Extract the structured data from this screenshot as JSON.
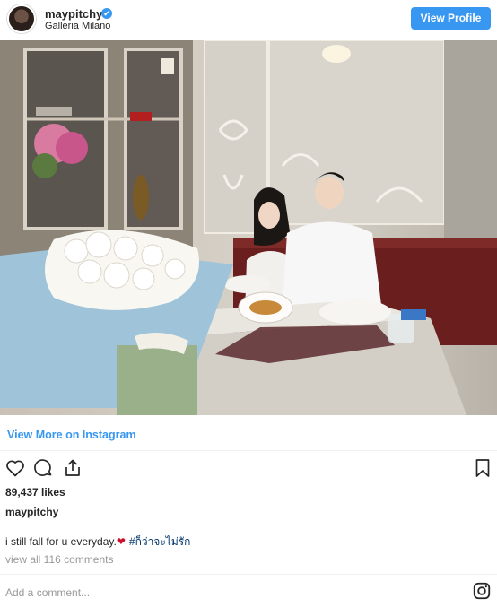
{
  "header": {
    "username": "maypitchy",
    "verified_mark": "✔",
    "location": "Galleria Milano",
    "view_profile_label": "View Profile"
  },
  "post": {
    "view_more_label": "View More on Instagram",
    "likes": "89,437 likes",
    "caption_username": "maypitchy",
    "caption_text": "i still fall for u everyday.",
    "caption_emoji": "❤",
    "caption_hashtag": "#ก็ว่าจะไม่รัก",
    "view_comments_label": "view all 116 comments",
    "add_comment_placeholder": "Add a comment..."
  },
  "icons": {
    "like": "heart-icon",
    "comment": "comment-bubble-icon",
    "share": "share-icon",
    "save": "bookmark-icon",
    "instagram": "instagram-logo-icon"
  },
  "colors": {
    "accent": "#3897f0",
    "text": "#262626",
    "muted": "#999999",
    "hashtag": "#003569",
    "divider": "#efefef"
  }
}
